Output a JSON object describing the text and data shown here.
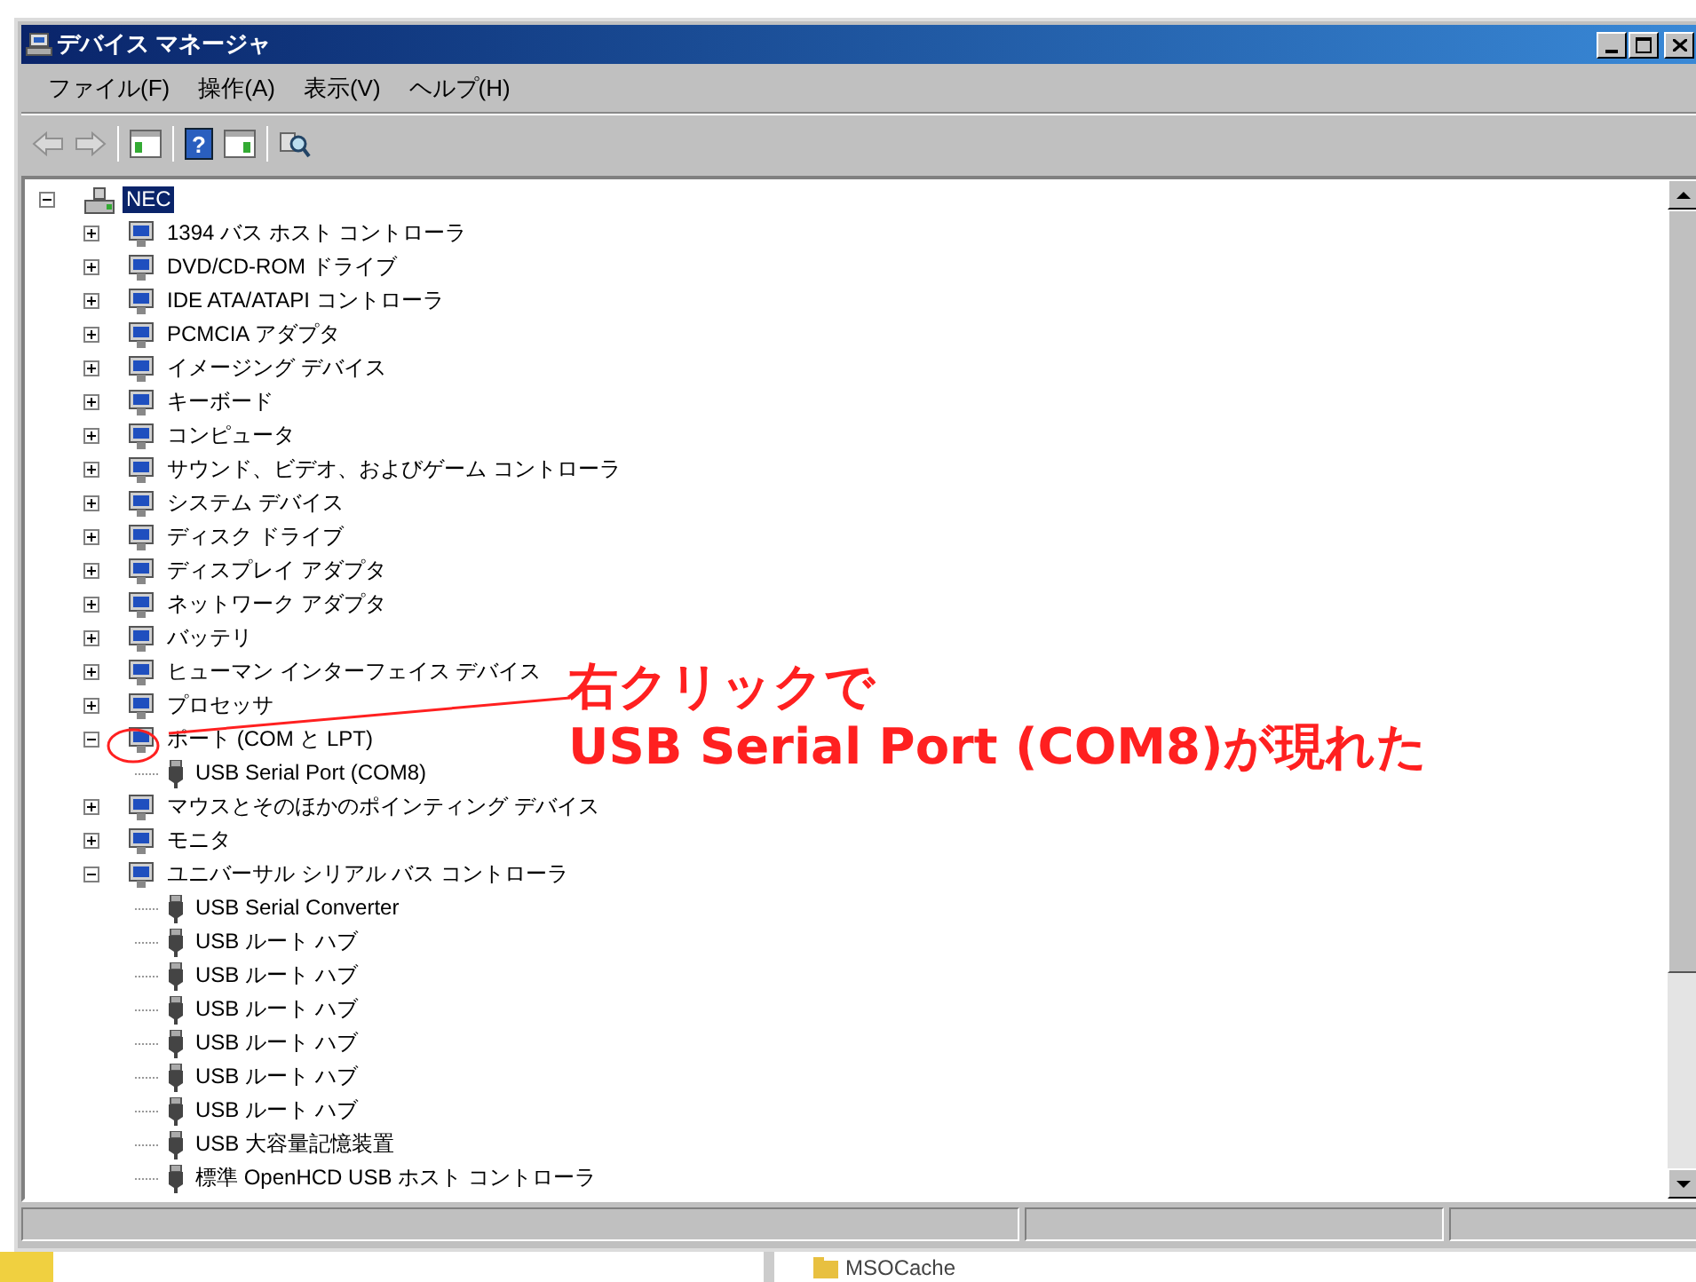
{
  "window": {
    "title": "デバイス マネージャ"
  },
  "menu": [
    "ファイル(F)",
    "操作(A)",
    "表示(V)",
    "ヘルプ(H)"
  ],
  "toolbar": {
    "help_glyph": "?"
  },
  "tree": [
    {
      "label": "NEC",
      "selected": true,
      "expanded": true,
      "children": [
        {
          "label": "1394 バス ホスト コントローラ",
          "selected": false,
          "expanded": false
        },
        {
          "label": "DVD/CD-ROM ドライブ",
          "selected": false,
          "expanded": false
        },
        {
          "label": "IDE ATA/ATAPI コントローラ",
          "selected": false,
          "expanded": false
        },
        {
          "label": "PCMCIA アダプタ",
          "selected": false,
          "expanded": false
        },
        {
          "label": "イメージング デバイス",
          "selected": false,
          "expanded": false
        },
        {
          "label": "キーボード",
          "selected": false,
          "expanded": false
        },
        {
          "label": "コンピュータ",
          "selected": false,
          "expanded": false
        },
        {
          "label": "サウンド、ビデオ、およびゲーム コントローラ",
          "selected": false,
          "expanded": false
        },
        {
          "label": "システム デバイス",
          "selected": false,
          "expanded": false
        },
        {
          "label": "ディスク ドライブ",
          "selected": false,
          "expanded": false
        },
        {
          "label": "ディスプレイ アダプタ",
          "selected": false,
          "expanded": false
        },
        {
          "label": "ネットワーク アダプタ",
          "selected": false,
          "expanded": false
        },
        {
          "label": "バッテリ",
          "selected": false,
          "expanded": false
        },
        {
          "label": "ヒューマン インターフェイス デバイス",
          "selected": false,
          "expanded": false
        },
        {
          "label": "プロセッサ",
          "selected": false,
          "expanded": false
        },
        {
          "label": "ポート (COM と LPT)",
          "selected": false,
          "expanded": true,
          "children": [
            {
              "label": "USB Serial Port (COM8)",
              "selected": false
            }
          ]
        },
        {
          "label": "マウスとそのほかのポインティング デバイス",
          "selected": false,
          "expanded": false
        },
        {
          "label": "モニタ",
          "selected": false,
          "expanded": false
        },
        {
          "label": "ユニバーサル シリアル バス コントローラ",
          "selected": false,
          "expanded": true,
          "children": [
            {
              "label": "USB Serial Converter",
              "selected": false
            },
            {
              "label": "USB ルート ハブ",
              "selected": false
            },
            {
              "label": "USB ルート ハブ",
              "selected": false
            },
            {
              "label": "USB ルート ハブ",
              "selected": false
            },
            {
              "label": "USB ルート ハブ",
              "selected": false
            },
            {
              "label": "USB ルート ハブ",
              "selected": false
            },
            {
              "label": "USB ルート ハブ",
              "selected": false
            },
            {
              "label": "USB 大容量記憶装置",
              "selected": false
            },
            {
              "label": "標準 OpenHCD USB ホスト コントローラ",
              "selected": false
            }
          ]
        }
      ]
    }
  ],
  "annotation": [
    "右クリックで",
    "USB Serial Port (COM8)が現れた"
  ],
  "background_window": {
    "item": "MSOCache"
  }
}
